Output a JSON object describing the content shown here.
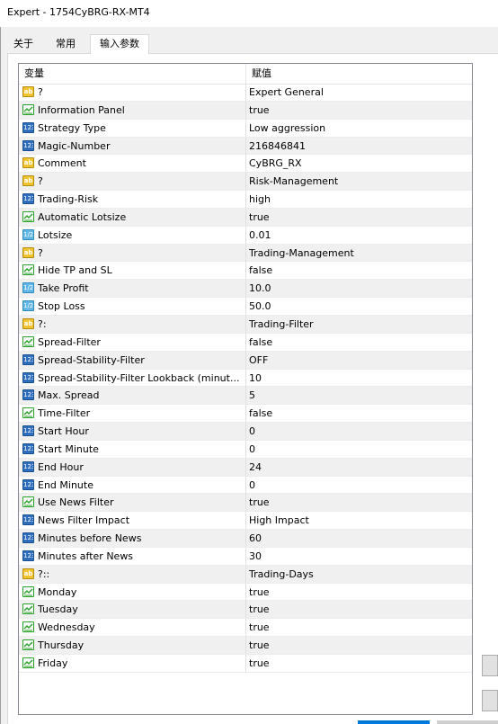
{
  "window": {
    "title": "Expert - 1754CyBRG-RX-MT4"
  },
  "tabs": [
    {
      "label": "关于",
      "active": false
    },
    {
      "label": "常用",
      "active": false
    },
    {
      "label": "输入参数",
      "active": true
    }
  ],
  "table": {
    "columns": [
      "变量",
      "赋值"
    ],
    "rows": [
      {
        "icon": "string-icon",
        "name": "?",
        "value": "Expert General"
      },
      {
        "icon": "bool-icon",
        "name": "Information Panel",
        "value": "true"
      },
      {
        "icon": "int-icon",
        "name": "Strategy Type",
        "value": "Low aggression"
      },
      {
        "icon": "int-icon",
        "name": "Magic-Number",
        "value": "216846841"
      },
      {
        "icon": "string-icon",
        "name": "Comment",
        "value": "CyBRG_RX"
      },
      {
        "icon": "string-icon",
        "name": "?",
        "value": "Risk-Management"
      },
      {
        "icon": "int-icon",
        "name": "Trading-Risk",
        "value": "high"
      },
      {
        "icon": "bool-icon",
        "name": "Automatic Lotsize",
        "value": "true"
      },
      {
        "icon": "double-icon",
        "name": "Lotsize",
        "value": "0.01"
      },
      {
        "icon": "string-icon",
        "name": "?",
        "value": "Trading-Management"
      },
      {
        "icon": "bool-icon",
        "name": "Hide TP and SL",
        "value": "false"
      },
      {
        "icon": "double-icon",
        "name": "Take Profit",
        "value": "10.0"
      },
      {
        "icon": "double-icon",
        "name": "Stop Loss",
        "value": "50.0"
      },
      {
        "icon": "string-icon",
        "name": "?:",
        "value": "Trading-Filter"
      },
      {
        "icon": "bool-icon",
        "name": "Spread-Filter",
        "value": "false"
      },
      {
        "icon": "int-icon",
        "name": "Spread-Stability-Filter",
        "value": "OFF"
      },
      {
        "icon": "int-icon",
        "name": "Spread-Stability-Filter Lookback (minut...",
        "value": "10"
      },
      {
        "icon": "int-icon",
        "name": "Max. Spread",
        "value": "5"
      },
      {
        "icon": "bool-icon",
        "name": "Time-Filter",
        "value": "false"
      },
      {
        "icon": "int-icon",
        "name": "Start Hour",
        "value": "0"
      },
      {
        "icon": "int-icon",
        "name": "Start Minute",
        "value": "0"
      },
      {
        "icon": "int-icon",
        "name": "End Hour",
        "value": "24"
      },
      {
        "icon": "int-icon",
        "name": "End Minute",
        "value": "0"
      },
      {
        "icon": "bool-icon",
        "name": "Use News Filter",
        "value": "true"
      },
      {
        "icon": "int-icon",
        "name": "News Filter Impact",
        "value": "High Impact"
      },
      {
        "icon": "int-icon",
        "name": "Minutes before News",
        "value": "60"
      },
      {
        "icon": "int-icon",
        "name": "Minutes after News",
        "value": "30"
      },
      {
        "icon": "string-icon",
        "name": "?::",
        "value": "Trading-Days"
      },
      {
        "icon": "bool-icon",
        "name": "Monday",
        "value": "true"
      },
      {
        "icon": "bool-icon",
        "name": "Tuesday",
        "value": "true"
      },
      {
        "icon": "bool-icon",
        "name": "Wednesday",
        "value": "true"
      },
      {
        "icon": "bool-icon",
        "name": "Thursday",
        "value": "true"
      },
      {
        "icon": "bool-icon",
        "name": "Friday",
        "value": "true"
      }
    ]
  },
  "icon_labels": {
    "string": "ab",
    "int": "123",
    "double": "1/2"
  },
  "colors": {
    "accent": "#0078d7",
    "alt_row": "#f0f0f0",
    "bool_icon": "#2aa12a",
    "int_icon": "#2f6fbe",
    "double_icon": "#63b7e6",
    "string_icon": "#f2c432"
  }
}
